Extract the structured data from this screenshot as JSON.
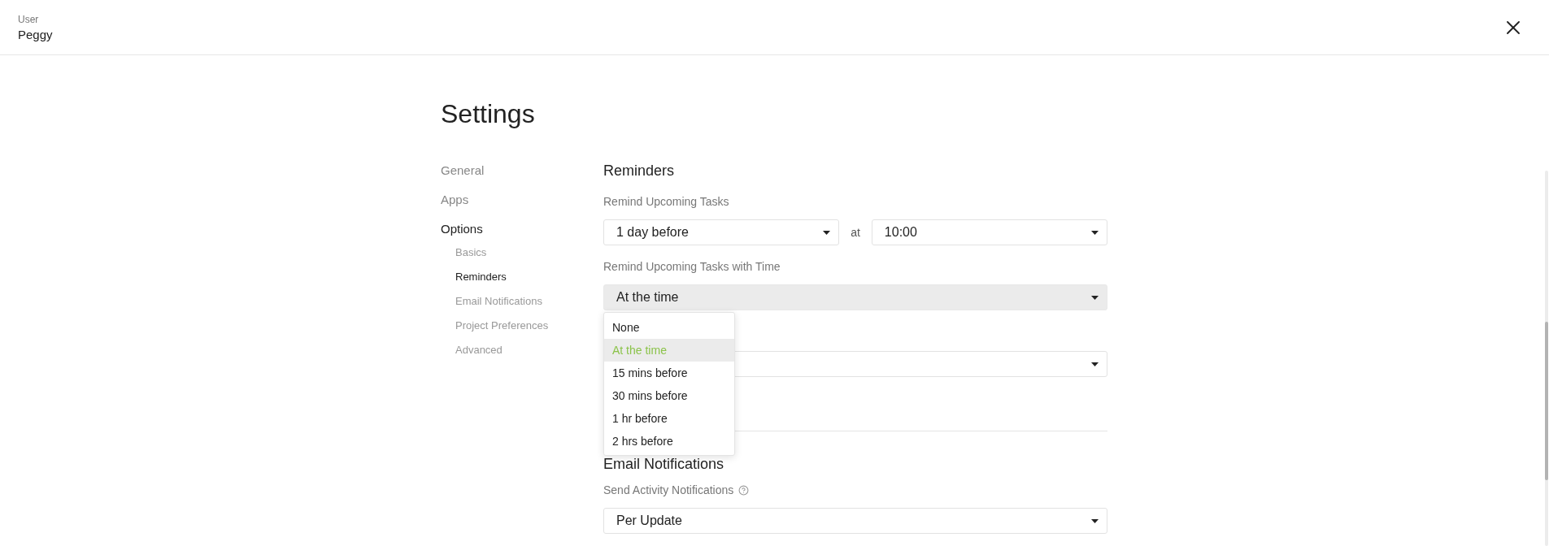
{
  "header": {
    "label": "User",
    "name": "Peggy"
  },
  "title": "Settings",
  "sidebar": {
    "items": [
      {
        "label": "General",
        "selected": false
      },
      {
        "label": "Apps",
        "selected": false
      },
      {
        "label": "Options",
        "selected": true,
        "children": [
          {
            "label": "Basics",
            "selected": false
          },
          {
            "label": "Reminders",
            "selected": true
          },
          {
            "label": "Email Notifications",
            "selected": false
          },
          {
            "label": "Project Preferences",
            "selected": false
          },
          {
            "label": "Advanced",
            "selected": false
          }
        ]
      }
    ]
  },
  "reminders": {
    "heading": "Reminders",
    "upcoming": {
      "label": "Remind Upcoming Tasks",
      "value": "1 day before",
      "joiner": "at",
      "time": "10:00"
    },
    "with_time": {
      "label": "Remind Upcoming Tasks with Time",
      "value": "At the time",
      "expanded": true,
      "options": [
        {
          "label": "None",
          "selected": false
        },
        {
          "label": "At the time",
          "selected": true
        },
        {
          "label": "15 mins before",
          "selected": false
        },
        {
          "label": "30 mins before",
          "selected": false
        },
        {
          "label": "1 hr before",
          "selected": false
        },
        {
          "label": "2 hrs before",
          "selected": false
        }
      ]
    }
  },
  "email": {
    "heading": "Email Notifications",
    "label": "Send Activity Notifications",
    "value": "Per Update"
  }
}
